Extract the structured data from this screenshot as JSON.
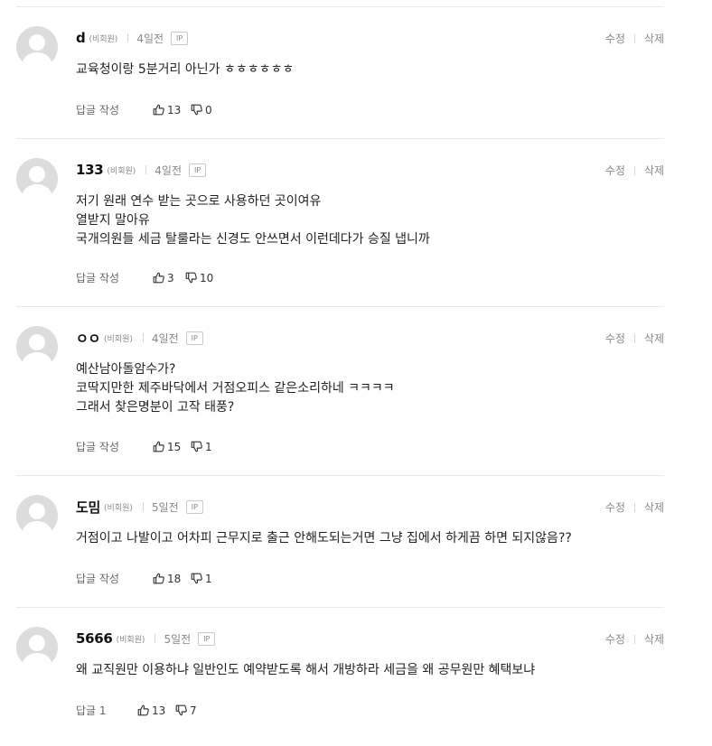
{
  "labels": {
    "guest": "(비회원)",
    "ip": "IP",
    "edit": "수정",
    "delete": "삭제",
    "reply_default": "답글 작성"
  },
  "comments": [
    {
      "nick": "d",
      "date": "4일전",
      "lines": [
        "교육청이랑 5분거리 아닌가 ㅎㅎㅎㅎㅎㅎ"
      ],
      "reply": "답글 작성",
      "up": "13",
      "down": "0"
    },
    {
      "nick": "133",
      "date": "4일전",
      "lines": [
        "저기 원래 연수 받는 곳으로 사용하던 곳이여유",
        "열받지 말아유",
        "국개의원들 세금 탈룰라는 신경도 안쓰면서 이런데다가 승질 냅니까"
      ],
      "reply": "답글 작성",
      "up": "3",
      "down": "10"
    },
    {
      "nick": "ㅇㅇ",
      "date": "4일전",
      "lines": [
        "예산남아돌암수가?",
        "코딱지만한 제주바닥에서 거점오피스 같은소리하네 ㅋㅋㅋㅋ",
        "그래서 찾은명분이 고작 태풍?"
      ],
      "reply": "답글 작성",
      "up": "15",
      "down": "1"
    },
    {
      "nick": "도밈",
      "date": "5일전",
      "lines": [
        "거점이고 나발이고 어차피 근무지로 출근 안해도되는거면 그냥 집에서 하게끔 하면 되지않음??"
      ],
      "reply": "답글 작성",
      "up": "18",
      "down": "1"
    },
    {
      "nick": "5666",
      "date": "5일전",
      "lines": [
        "왜 교직원만 이용하냐 일반인도 예약받도록 해서 개방하라 세금을 왜 공무원만 혜택보냐"
      ],
      "reply": "답글 1",
      "up": "13",
      "down": "7"
    }
  ]
}
